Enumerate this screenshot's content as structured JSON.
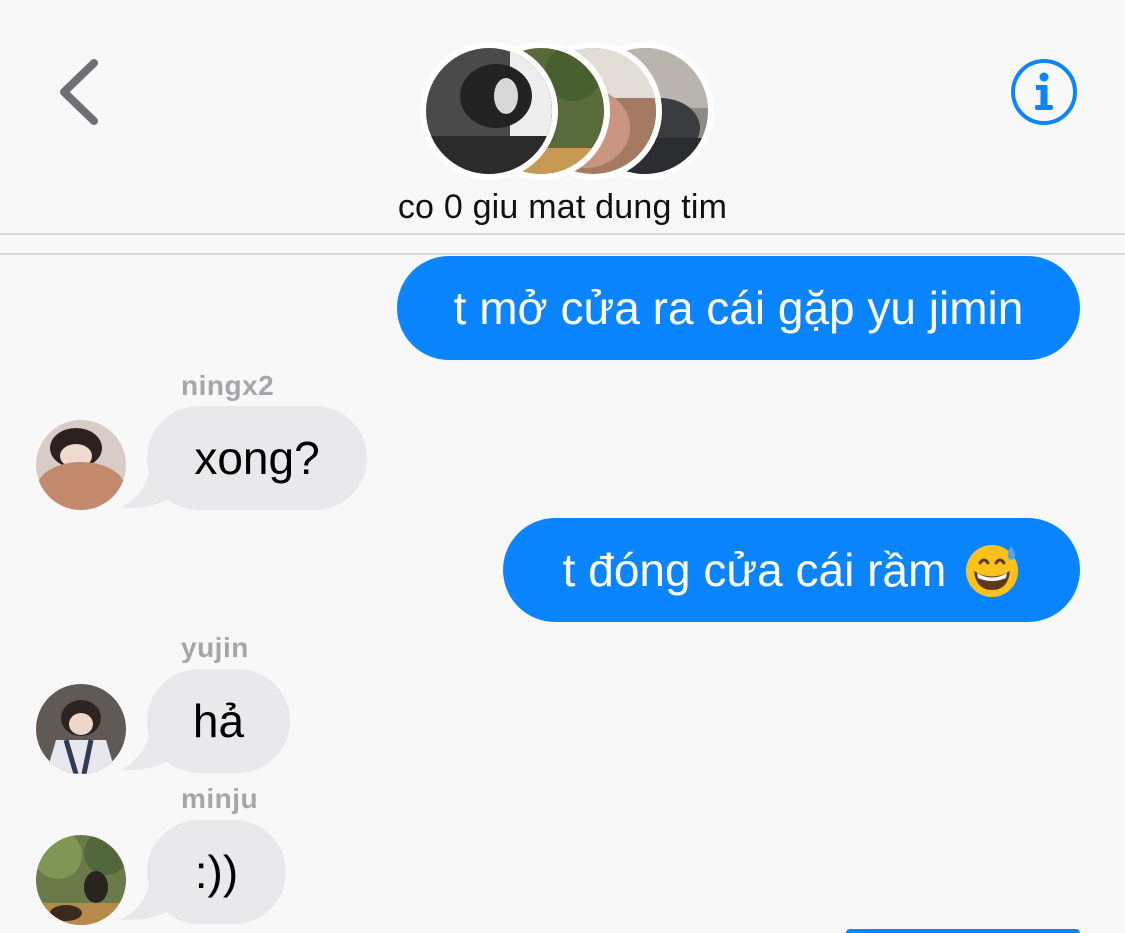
{
  "header": {
    "group_name": "co 0 giu mat dung tim",
    "back_icon": "chevron-left-icon",
    "info_icon": "info-circle-icon",
    "accent_color": "#0a84ff",
    "member_avatars": [
      "avatar-1",
      "avatar-2",
      "avatar-3",
      "avatar-4"
    ]
  },
  "messages": [
    {
      "type": "sent",
      "text": "t mở cửa ra cái gặp yu jimin"
    },
    {
      "type": "received",
      "sender": "ningx2",
      "text": "xong?"
    },
    {
      "type": "sent",
      "text": "t đóng cửa cái rầm",
      "emoji": "grinning-face-with-sweat"
    },
    {
      "type": "received",
      "sender": "yujin",
      "text": "hả"
    },
    {
      "type": "received",
      "sender": "minju",
      "text": ":))"
    }
  ],
  "colors": {
    "sent_bubble": "#0a84ff",
    "received_bubble": "#e9e9eb",
    "background": "#f8f8f8",
    "sender_name": "#a6a6aa"
  }
}
